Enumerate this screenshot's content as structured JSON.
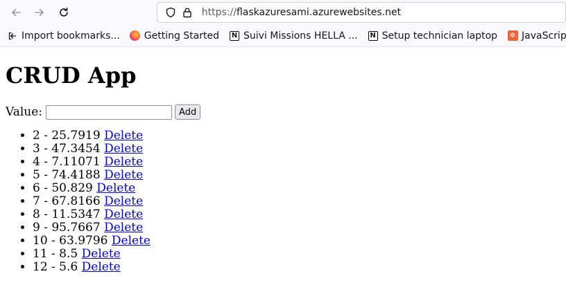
{
  "browser": {
    "url_prefix": "https://",
    "url_host": "flaskazuresami.azurewebsites.net",
    "bookmarks": [
      {
        "label": "Import bookmarks...",
        "icon": "import-icon"
      },
      {
        "label": "Getting Started",
        "icon": "firefox-icon"
      },
      {
        "label": "Suivi Missions HELLA ...",
        "icon": "notion-icon"
      },
      {
        "label": "Setup technician laptop",
        "icon": "notion-icon"
      },
      {
        "label": "JavaScript Dict",
        "icon": "hubspot-icon"
      }
    ]
  },
  "page": {
    "title": "CRUD App",
    "value_label": "Value:",
    "value_input": "",
    "add_label": "Add",
    "delete_label": "Delete",
    "items": [
      {
        "id": "2",
        "value": "25.7919"
      },
      {
        "id": "3",
        "value": "47.3454"
      },
      {
        "id": "4",
        "value": "7.11071"
      },
      {
        "id": "5",
        "value": "74.4188"
      },
      {
        "id": "6",
        "value": "50.829"
      },
      {
        "id": "7",
        "value": "67.8166"
      },
      {
        "id": "8",
        "value": "11.5347"
      },
      {
        "id": "9",
        "value": "95.7667"
      },
      {
        "id": "10",
        "value": "63.9796"
      },
      {
        "id": "11",
        "value": "8.5"
      },
      {
        "id": "12",
        "value": "5.6"
      }
    ]
  }
}
